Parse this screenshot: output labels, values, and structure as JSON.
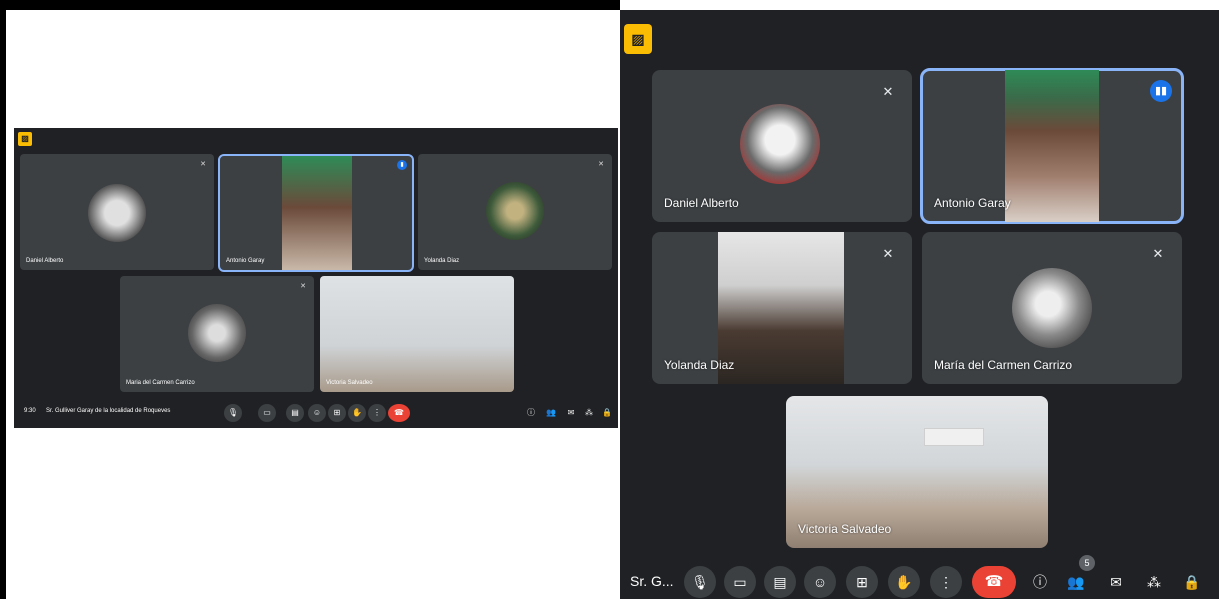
{
  "meeting": {
    "time": "9:30",
    "title": "Sr. Gulliver Garay de la localidad de Roqueves",
    "title_short": "Sr. G...",
    "participant_count": "5"
  },
  "participants": [
    {
      "name": "Daniel Alberto",
      "muted": true
    },
    {
      "name": "Antonio Garay",
      "speaking": true
    },
    {
      "name": "Yolanda Diaz",
      "muted": true
    },
    {
      "name": "María del Carmen Carrizo",
      "muted": true
    },
    {
      "name": "Victoria Salvadeo"
    }
  ],
  "left_names": {
    "daniel": "Daniel Alberto",
    "antonio": "Antonio Garay",
    "yolanda": "Yolanda Diaz",
    "maria": "Maria del Carmen Carrizo",
    "victoria": "Victoria Salvadeo"
  },
  "icons": {
    "pin": "present-icon",
    "mic": "mic-icon",
    "camera": "camera-icon",
    "captions": "captions-icon",
    "emoji": "emoji-icon",
    "present": "present-screen-icon",
    "hand": "raise-hand-icon",
    "more": "more-options-icon",
    "end": "end-call-icon",
    "info": "info-icon",
    "people": "people-icon",
    "chat": "chat-icon",
    "activities": "activities-icon",
    "lock": "host-controls-icon"
  },
  "colors": {
    "background": "#202124",
    "tile": "#3c4043",
    "accent": "#8ab4f8",
    "end_call": "#ea4335",
    "speaking": "#1a73e8",
    "badge": "#fbbc04"
  }
}
